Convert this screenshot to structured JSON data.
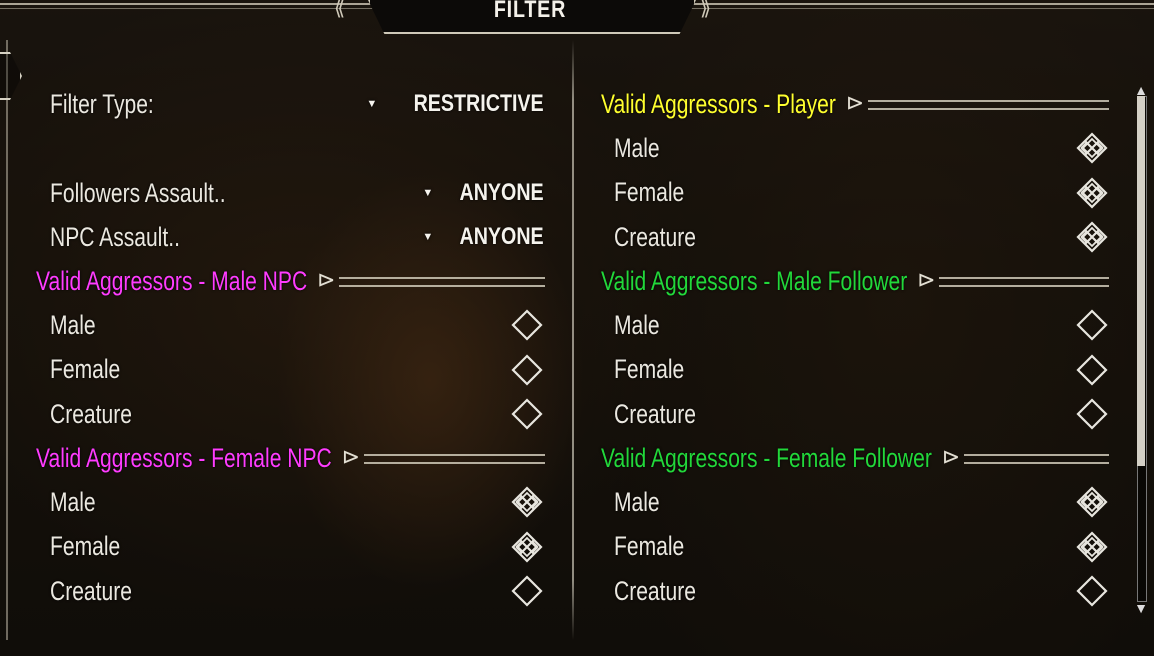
{
  "title": "FILTER",
  "left": {
    "settings": [
      {
        "label": "Filter Type:",
        "value": "RESTRICTIVE"
      },
      {
        "label": "Followers Assault..",
        "value": "ANYONE"
      },
      {
        "label": "NPC Assault..",
        "value": "ANYONE"
      }
    ],
    "sections": [
      {
        "header": "Valid Aggressors - Male NPC",
        "color": "#ff3cff",
        "items": [
          {
            "label": "Male",
            "checked": false
          },
          {
            "label": "Female",
            "checked": false
          },
          {
            "label": "Creature",
            "checked": false
          }
        ]
      },
      {
        "header": "Valid Aggressors - Female NPC",
        "color": "#ff3cff",
        "items": [
          {
            "label": "Male",
            "checked": true
          },
          {
            "label": "Female",
            "checked": true
          },
          {
            "label": "Creature",
            "checked": false
          }
        ]
      }
    ]
  },
  "right": {
    "sections": [
      {
        "header": "Valid Aggressors - Player",
        "color": "#ffff2e",
        "items": [
          {
            "label": "Male",
            "checked": true
          },
          {
            "label": "Female",
            "checked": true
          },
          {
            "label": "Creature",
            "checked": true
          }
        ]
      },
      {
        "header": "Valid Aggressors - Male Follower",
        "color": "#22d83a",
        "items": [
          {
            "label": "Male",
            "checked": false
          },
          {
            "label": "Female",
            "checked": false
          },
          {
            "label": "Creature",
            "checked": false
          }
        ]
      },
      {
        "header": "Valid Aggressors - Female Follower",
        "color": "#22d83a",
        "items": [
          {
            "label": "Male",
            "checked": true
          },
          {
            "label": "Female",
            "checked": true
          },
          {
            "label": "Creature",
            "checked": false
          }
        ]
      }
    ]
  },
  "icons": {
    "dropdown": "triangle-down-icon",
    "checkbox_on": "knot-checked-icon",
    "checkbox_off": "diamond-unchecked-icon",
    "section_arrow": "section-arrow-icon"
  }
}
